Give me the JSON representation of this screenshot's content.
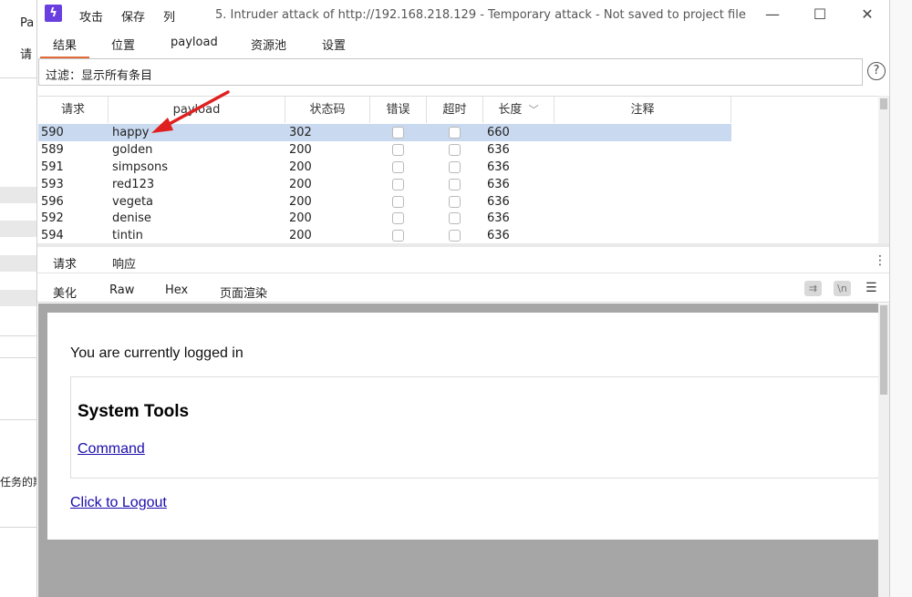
{
  "background": {
    "fragment_top": "Pa",
    "fragment_mid": "请",
    "fragment_bottom": "任务的期"
  },
  "titlebar": {
    "menu": [
      "攻击",
      "保存",
      "列"
    ],
    "title": "5. Intruder attack of http://192.168.218.129 - Temporary attack - Not saved to project file",
    "minimize": "—",
    "maximize": "☐",
    "close": "✕"
  },
  "main_tabs": [
    "结果",
    "位置",
    "payload",
    "资源池",
    "设置"
  ],
  "filter": {
    "label": "过滤：显示所有条目",
    "help": "?"
  },
  "table": {
    "columns": [
      "请求",
      "payload",
      "状态码",
      "错误",
      "超时",
      "长度",
      "注释"
    ],
    "sort_indicator": "﹀",
    "rows": [
      {
        "req": "590",
        "payload": "happy",
        "status": "302",
        "length": "660"
      },
      {
        "req": "589",
        "payload": "golden",
        "status": "200",
        "length": "636"
      },
      {
        "req": "591",
        "payload": "simpsons",
        "status": "200",
        "length": "636"
      },
      {
        "req": "593",
        "payload": "red123",
        "status": "200",
        "length": "636"
      },
      {
        "req": "596",
        "payload": "vegeta",
        "status": "200",
        "length": "636"
      },
      {
        "req": "592",
        "payload": "denise",
        "status": "200",
        "length": "636"
      },
      {
        "req": "594",
        "payload": "tintin",
        "status": "200",
        "length": "636"
      }
    ]
  },
  "sub_tabs": [
    "请求",
    "响应"
  ],
  "view_tabs": [
    "美化",
    "Raw",
    "Hex",
    "页面渲染"
  ],
  "view_tools": {
    "wrap": "⇉",
    "newline": "\\n",
    "menu": "☰"
  },
  "render": {
    "status": "You are currently logged in",
    "section_title": "System Tools",
    "command_link": "Command",
    "logout_link": "Click to Logout"
  },
  "colors": {
    "accent": "#e06c3a",
    "selected_row": "#c9d9ef",
    "annotation_arrow": "#e02020",
    "logo": "#6a3fe0"
  }
}
